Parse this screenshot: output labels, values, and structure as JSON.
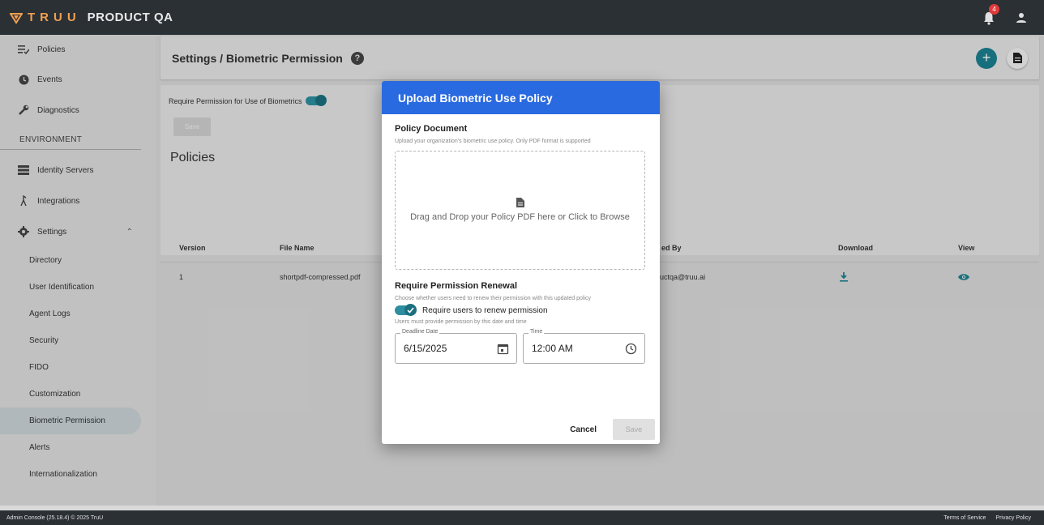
{
  "topbar": {
    "logo_text": "TRUU",
    "product": "PRODUCT QA",
    "notification_count": "4"
  },
  "sidebar": {
    "items": [
      {
        "label": "Policies"
      },
      {
        "label": "Events"
      },
      {
        "label": "Diagnostics"
      }
    ],
    "env_label": "ENVIRONMENT",
    "env_items": [
      {
        "label": "Identity Servers"
      },
      {
        "label": "Integrations"
      },
      {
        "label": "Settings"
      }
    ],
    "settings_sub": [
      {
        "label": "Directory"
      },
      {
        "label": "User Identification"
      },
      {
        "label": "Agent Logs"
      },
      {
        "label": "Security"
      },
      {
        "label": "FIDO"
      },
      {
        "label": "Customization"
      },
      {
        "label": "Biometric Permission"
      },
      {
        "label": "Alerts"
      },
      {
        "label": "Internationalization"
      }
    ]
  },
  "header": {
    "title": "Settings / Biometric Permission",
    "help_glyph": "?"
  },
  "content": {
    "perm_label": "Require Permission for Use of Biometrics",
    "save_label": "Save",
    "policies_title": "Policies",
    "columns": [
      "Version",
      "File Name",
      "ed By",
      "Download",
      "View"
    ],
    "rows": [
      {
        "version": "1",
        "file_name": "shortpdf-compressed.pdf",
        "uploaded_by": "uctqa@truu.ai"
      }
    ]
  },
  "modal": {
    "title": "Upload Biometric Use Policy",
    "doc_title": "Policy Document",
    "doc_desc": "Upload your organization's biometric use policy. Only PDF format is supported",
    "dropzone_text": "Drag and Drop your Policy PDF here or Click to Browse",
    "renew_title": "Require Permission Renewal",
    "renew_desc": "Choose whether users need to renew their permission with this updated policy",
    "renew_toggle_label": "Require users to renew permission",
    "deadline_hint": "Users must provide permission by this date and time",
    "deadline_label": "Deadline Date",
    "deadline_value": "6/15/2025",
    "time_label": "Time",
    "time_value": "12:00 AM",
    "cancel_label": "Cancel",
    "save_label": "Save"
  },
  "footer": {
    "left": "Admin Console (25.18.4) © 2025 TruU",
    "terms": "Terms of Service",
    "privacy": "Privacy Policy"
  },
  "colors": {
    "topbar": "#2b3035",
    "modal_header": "#2a6ae0",
    "accent": "#2d8ea0",
    "logo": "#f0a050"
  }
}
